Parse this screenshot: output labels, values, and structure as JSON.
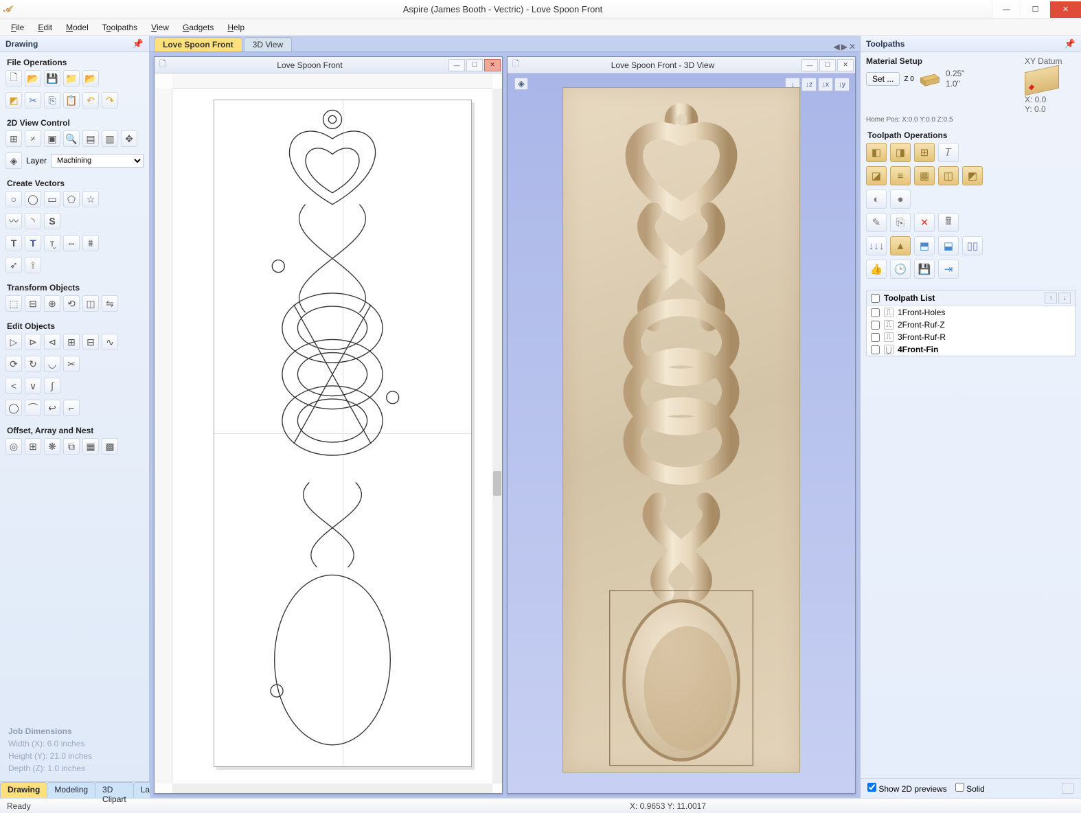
{
  "window": {
    "title": "Aspire (James Booth - Vectric) - Love Spoon Front"
  },
  "menu": [
    "File",
    "Edit",
    "Model",
    "Toolpaths",
    "View",
    "Gadgets",
    "Help"
  ],
  "left": {
    "title": "Drawing",
    "sections": {
      "fileops": "File Operations",
      "viewctrl": "2D View Control",
      "layer_lbl": "Layer",
      "layer_val": "Machining",
      "createvec": "Create Vectors",
      "transform": "Transform Objects",
      "editobj": "Edit Objects",
      "offset": "Offset, Array and Nest"
    },
    "jobdim": {
      "hdr": "Job Dimensions",
      "w": "Width  (X): 6.0 inches",
      "h": "Height (Y): 21.0 inches",
      "d": "Depth  (Z): 1.0 inches"
    },
    "tabs": [
      "Drawing",
      "Modeling",
      "3D Clipart",
      "Layers"
    ]
  },
  "center": {
    "tabs": [
      "Love Spoon Front",
      "3D View"
    ],
    "mdi2d_title": "Love Spoon Front",
    "mdi3d_title": "Love Spoon Front - 3D View"
  },
  "right": {
    "title": "Toolpaths",
    "material_setup": "Material Setup",
    "set_btn": "Set ...",
    "z0": "Z 0",
    "thicktop": "0.25\"",
    "thickbot": "1.0\"",
    "homepos": "Home Pos:   X:0.0 Y:0.0 Z:0.5",
    "datum_lbl": "XY Datum",
    "datum_x": "X: 0.0",
    "datum_y": "Y: 0.0",
    "tpops": "Toolpath Operations",
    "tplist_hdr": "Toolpath List",
    "tplist": [
      "1Front-Holes",
      "2Front-Ruf-Z",
      "3Front-Ruf-R",
      "4Front-Fin"
    ],
    "show2d": "Show 2D previews",
    "solid": "Solid"
  },
  "status": {
    "ready": "Ready",
    "coords": "X: 0.9653 Y: 11.0017"
  }
}
